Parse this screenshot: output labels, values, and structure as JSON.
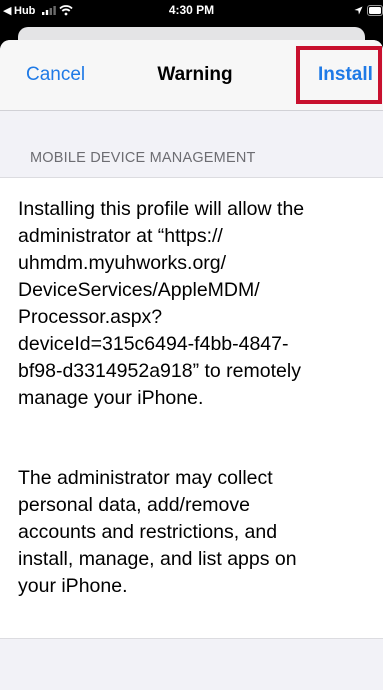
{
  "status_bar": {
    "back_glyph": "◀",
    "carrier": "Hub",
    "time": "4:30 PM",
    "icons": [
      "signal-icon",
      "wifi-icon",
      "location-icon",
      "battery-icon"
    ]
  },
  "nav": {
    "cancel_label": "Cancel",
    "title": "Warning",
    "install_label": "Install",
    "accent_color": "#1f7ae6",
    "highlight_color": "#c8102e"
  },
  "section": {
    "header": "MOBILE DEVICE MANAGEMENT",
    "paragraph_1": "Installing this profile will allow the\nadministrator at “https://\nuhmdm.myuhworks.org/\nDeviceServices/AppleMDM/\nProcessor.aspx?\ndeviceId=315c6494-f4bb-4847-\nbf98-d3314952a918” to remotely\nmanage your iPhone.",
    "paragraph_2": "The administrator may collect\npersonal data, add/remove\naccounts and restrictions, and\ninstall, manage, and list apps on\nyour iPhone."
  }
}
